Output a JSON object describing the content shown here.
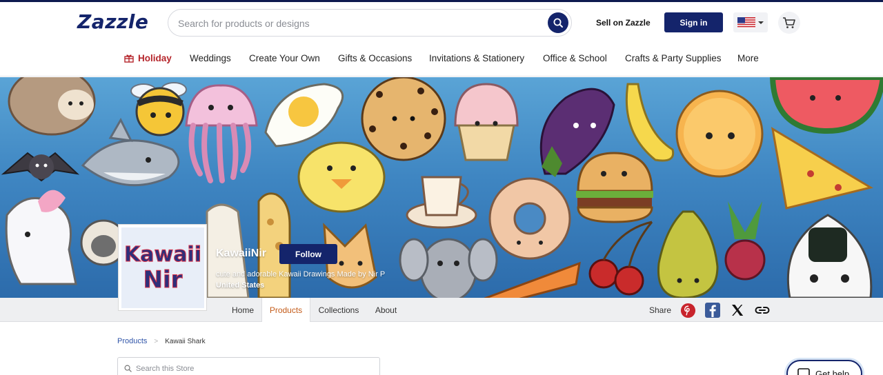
{
  "header": {
    "logo": "Zazzle",
    "search_placeholder": "Search for products or designs",
    "sell_label": "Sell on Zazzle",
    "signin_label": "Sign in",
    "locale_icon": "us-flag-icon",
    "cart_icon": "cart-icon"
  },
  "nav": {
    "items": [
      {
        "label": "Holiday",
        "icon": "gift-icon"
      },
      {
        "label": "Weddings"
      },
      {
        "label": "Create Your Own"
      },
      {
        "label": "Gifts & Occasions"
      },
      {
        "label": "Invitations & Stationery"
      },
      {
        "label": "Office & School"
      },
      {
        "label": "Crafts & Party Supplies"
      },
      {
        "label": "More"
      }
    ]
  },
  "store": {
    "avatar_line1": "Kawaii",
    "avatar_line2": "Nir",
    "name": "KawaiiNir",
    "follow_label": "Follow",
    "description": "cute and adorable Kawaii Drawings Made by Nir P",
    "country": "United States",
    "tabs": [
      "Home",
      "Products",
      "Collections",
      "About"
    ],
    "active_tab": "Products",
    "share_label": "Share",
    "social_icons": [
      "pinterest-icon",
      "facebook-icon",
      "x-icon",
      "link-icon"
    ]
  },
  "breadcrumb": {
    "root": "Products",
    "separator": ">",
    "current": "Kawaii Shark"
  },
  "store_search": {
    "placeholder": "Search this Store"
  },
  "help": {
    "label": "Get help"
  },
  "colors": {
    "brand_navy": "#14246b",
    "holiday_red": "#b5252b",
    "active_tab_orange": "#c45c1a",
    "pinterest_red": "#c8232c",
    "facebook_blue": "#3b5b9a"
  }
}
